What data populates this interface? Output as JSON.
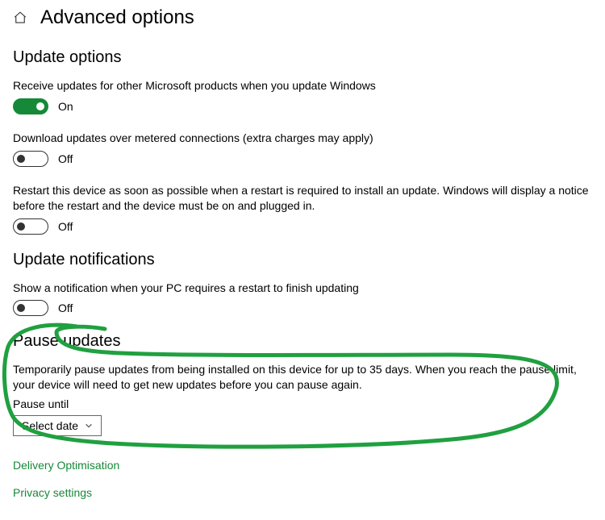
{
  "header": {
    "title": "Advanced options"
  },
  "sections": {
    "update_options": {
      "title": "Update options",
      "receive_updates": {
        "text": "Receive updates for other Microsoft products when you update Windows",
        "state_label": "On"
      },
      "metered": {
        "text": "Download updates over metered connections (extra charges may apply)",
        "state_label": "Off"
      },
      "restart": {
        "text": "Restart this device as soon as possible when a restart is required to install an update. Windows will display a notice before the restart and the device must be on and plugged in.",
        "state_label": "Off"
      }
    },
    "notifications": {
      "title": "Update notifications",
      "show_notification": {
        "text": "Show a notification when your PC requires a restart to finish updating",
        "state_label": "Off"
      }
    },
    "pause": {
      "title": "Pause updates",
      "description": "Temporarily pause updates from being installed on this device for up to 35 days. When you reach the pause limit, your device will need to get new updates before you can pause again.",
      "pause_until_label": "Pause until",
      "select_label": "Select date"
    }
  },
  "links": {
    "delivery": "Delivery Optimisation",
    "privacy": "Privacy settings"
  },
  "colors": {
    "accent": "#168938",
    "link": "#168938"
  }
}
